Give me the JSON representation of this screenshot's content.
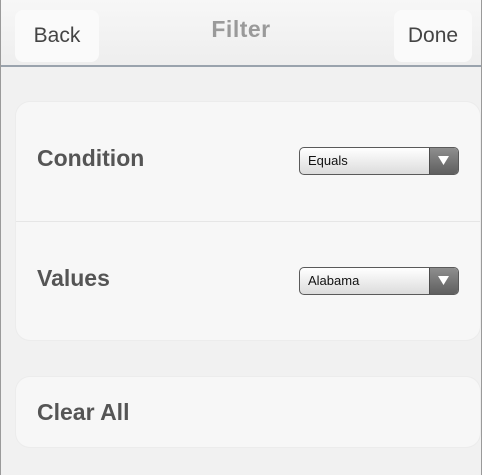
{
  "navbar": {
    "back_label": "Back",
    "title": "Filter",
    "done_label": "Done"
  },
  "filter": {
    "condition": {
      "label": "Condition",
      "selected": "Equals"
    },
    "values": {
      "label": "Values",
      "selected": "Alabama"
    }
  },
  "actions": {
    "clear_all_label": "Clear All"
  },
  "icons": {
    "dropdown": "chevron-down-icon"
  },
  "colors": {
    "background": "#f1f1f1",
    "group_background": "#f7f7f7",
    "label_text": "#555555",
    "title_text": "#9a9a9a",
    "nav_border": "#9aa3ad"
  }
}
